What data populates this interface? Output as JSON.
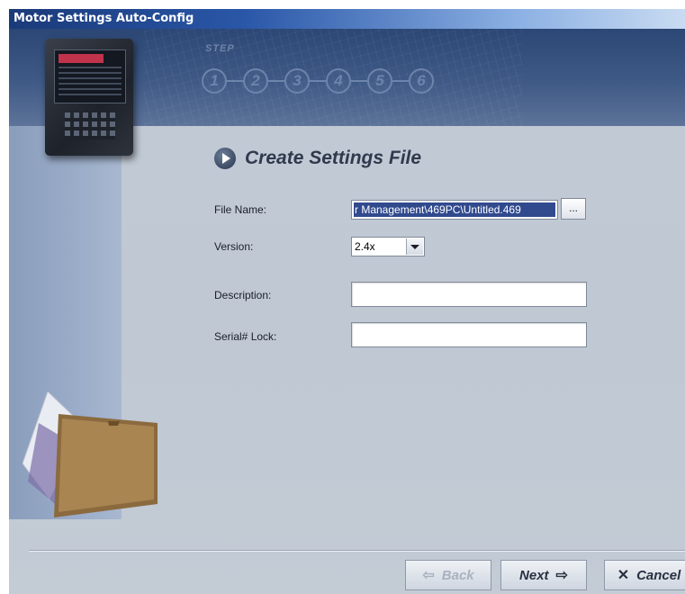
{
  "window": {
    "title": "Motor Settings Auto-Config"
  },
  "wizard": {
    "step_label": "STEP",
    "steps": [
      "1",
      "2",
      "3",
      "4",
      "5",
      "6"
    ]
  },
  "section": {
    "title": "Create Settings File"
  },
  "form": {
    "file_name_label": "File Name:",
    "file_name_value": "r Management\\469PC\\Untitled.469",
    "browse_label": "...",
    "version_label": "Version:",
    "version_value": "2.4x",
    "description_label": "Description:",
    "description_value": "",
    "serial_lock_label": "Serial# Lock:",
    "serial_lock_value": ""
  },
  "buttons": {
    "back_label": "Back",
    "next_label": "Next",
    "cancel_label": "Cancel"
  },
  "icons": {
    "back": "arrow-left-icon",
    "next": "arrow-right-icon",
    "cancel": "close-icon"
  }
}
